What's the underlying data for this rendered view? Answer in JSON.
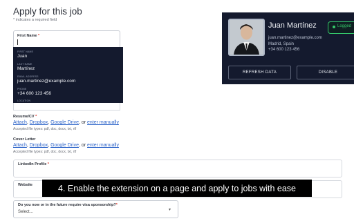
{
  "form": {
    "title": "Apply for this job",
    "required_note": "* indicates a required field",
    "required_star": "*",
    "first_name": {
      "label": "First Name",
      "value": ""
    },
    "autofill": {
      "items": [
        {
          "label": "FIRST NAME",
          "value": "Juan"
        },
        {
          "label": "LAST NAME",
          "value": "Martínez"
        },
        {
          "label": "EMAIL ADDRESS",
          "value": "juan.martinez@example.com"
        },
        {
          "label": "PHONE",
          "value": "+34 600 123 456"
        },
        {
          "label": "LOCATION",
          "value": ""
        }
      ]
    },
    "resume": {
      "label": "Resume/CV",
      "attach": "Attach",
      "dropbox": "Dropbox",
      "google_drive": "Google Drive",
      "or": ", or ",
      "manual": "enter manually",
      "types": "Accepted file types: pdf, doc, docx, txt, rtf"
    },
    "cover_letter": {
      "label": "Cover Letter",
      "attach": "Attach",
      "dropbox": "Dropbox",
      "google_drive": "Google Drive",
      "or": ", or ",
      "manual": "enter manually",
      "types": "Accepted file types: pdf, doc, docx, txt, rtf"
    },
    "linkedin": {
      "label": "LinkedIn Profile",
      "value": ""
    },
    "website": {
      "label": "Website",
      "value": ""
    },
    "visa": {
      "label": "Do you now or in the future require visa sponsorship?",
      "value": "Select..."
    }
  },
  "extension": {
    "name": "Juan Martínez",
    "email": "juan.martinez@example.com",
    "location": "Madrid, Spain",
    "phone": "+34 600 123 456",
    "status": "Logged",
    "refresh_label": "REFRESH DATA",
    "disable_label": "DISABLE",
    "status_color": "#34c66a"
  },
  "caption": "4. Enable the extension on a page and apply to jobs with ease"
}
